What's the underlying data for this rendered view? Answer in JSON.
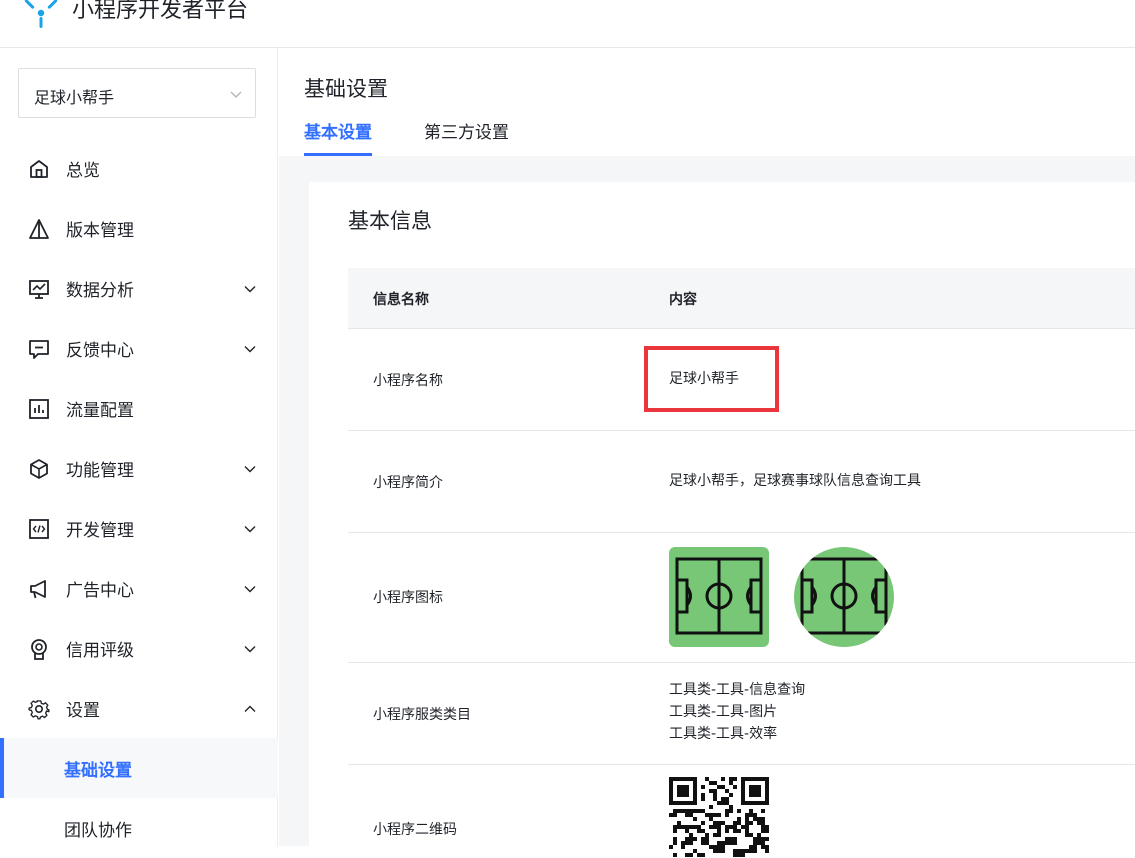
{
  "header": {
    "brand": "小程序开发者平台"
  },
  "sidebar": {
    "app_select": "足球小帮手",
    "items": [
      {
        "label": "总览",
        "icon": "home-icon"
      },
      {
        "label": "版本管理",
        "icon": "version-icon"
      },
      {
        "label": "数据分析",
        "icon": "chart-icon"
      },
      {
        "label": "反馈中心",
        "icon": "feedback-icon"
      },
      {
        "label": "流量配置",
        "icon": "traffic-icon"
      },
      {
        "label": "功能管理",
        "icon": "cube-icon"
      },
      {
        "label": "开发管理",
        "icon": "code-icon"
      },
      {
        "label": "广告中心",
        "icon": "megaphone-icon"
      },
      {
        "label": "信用评级",
        "icon": "badge-icon"
      },
      {
        "label": "设置",
        "icon": "gear-icon"
      }
    ],
    "sub_items": [
      {
        "label": "基础设置"
      },
      {
        "label": "团队协作"
      }
    ]
  },
  "page": {
    "title": "基础设置",
    "tabs": [
      {
        "label": "基本设置"
      },
      {
        "label": "第三方设置"
      }
    ]
  },
  "card": {
    "title": "基本信息",
    "columns": [
      "信息名称",
      "内容"
    ],
    "rows": {
      "name": {
        "key": "小程序名称",
        "value": "足球小帮手"
      },
      "intro": {
        "key": "小程序简介",
        "value": "足球小帮手，足球赛事球队信息查询工具"
      },
      "icon": {
        "key": "小程序图标"
      },
      "category": {
        "key": "小程序服类类目",
        "values": [
          "工具类-工具-信息查询",
          "工具类-工具-图片",
          "工具类-工具-效率"
        ]
      },
      "qrcode": {
        "key": "小程序二维码"
      }
    }
  },
  "colors": {
    "accent": "#3370ff",
    "highlight": "#e8363a",
    "icon_bg": "#77c777"
  }
}
